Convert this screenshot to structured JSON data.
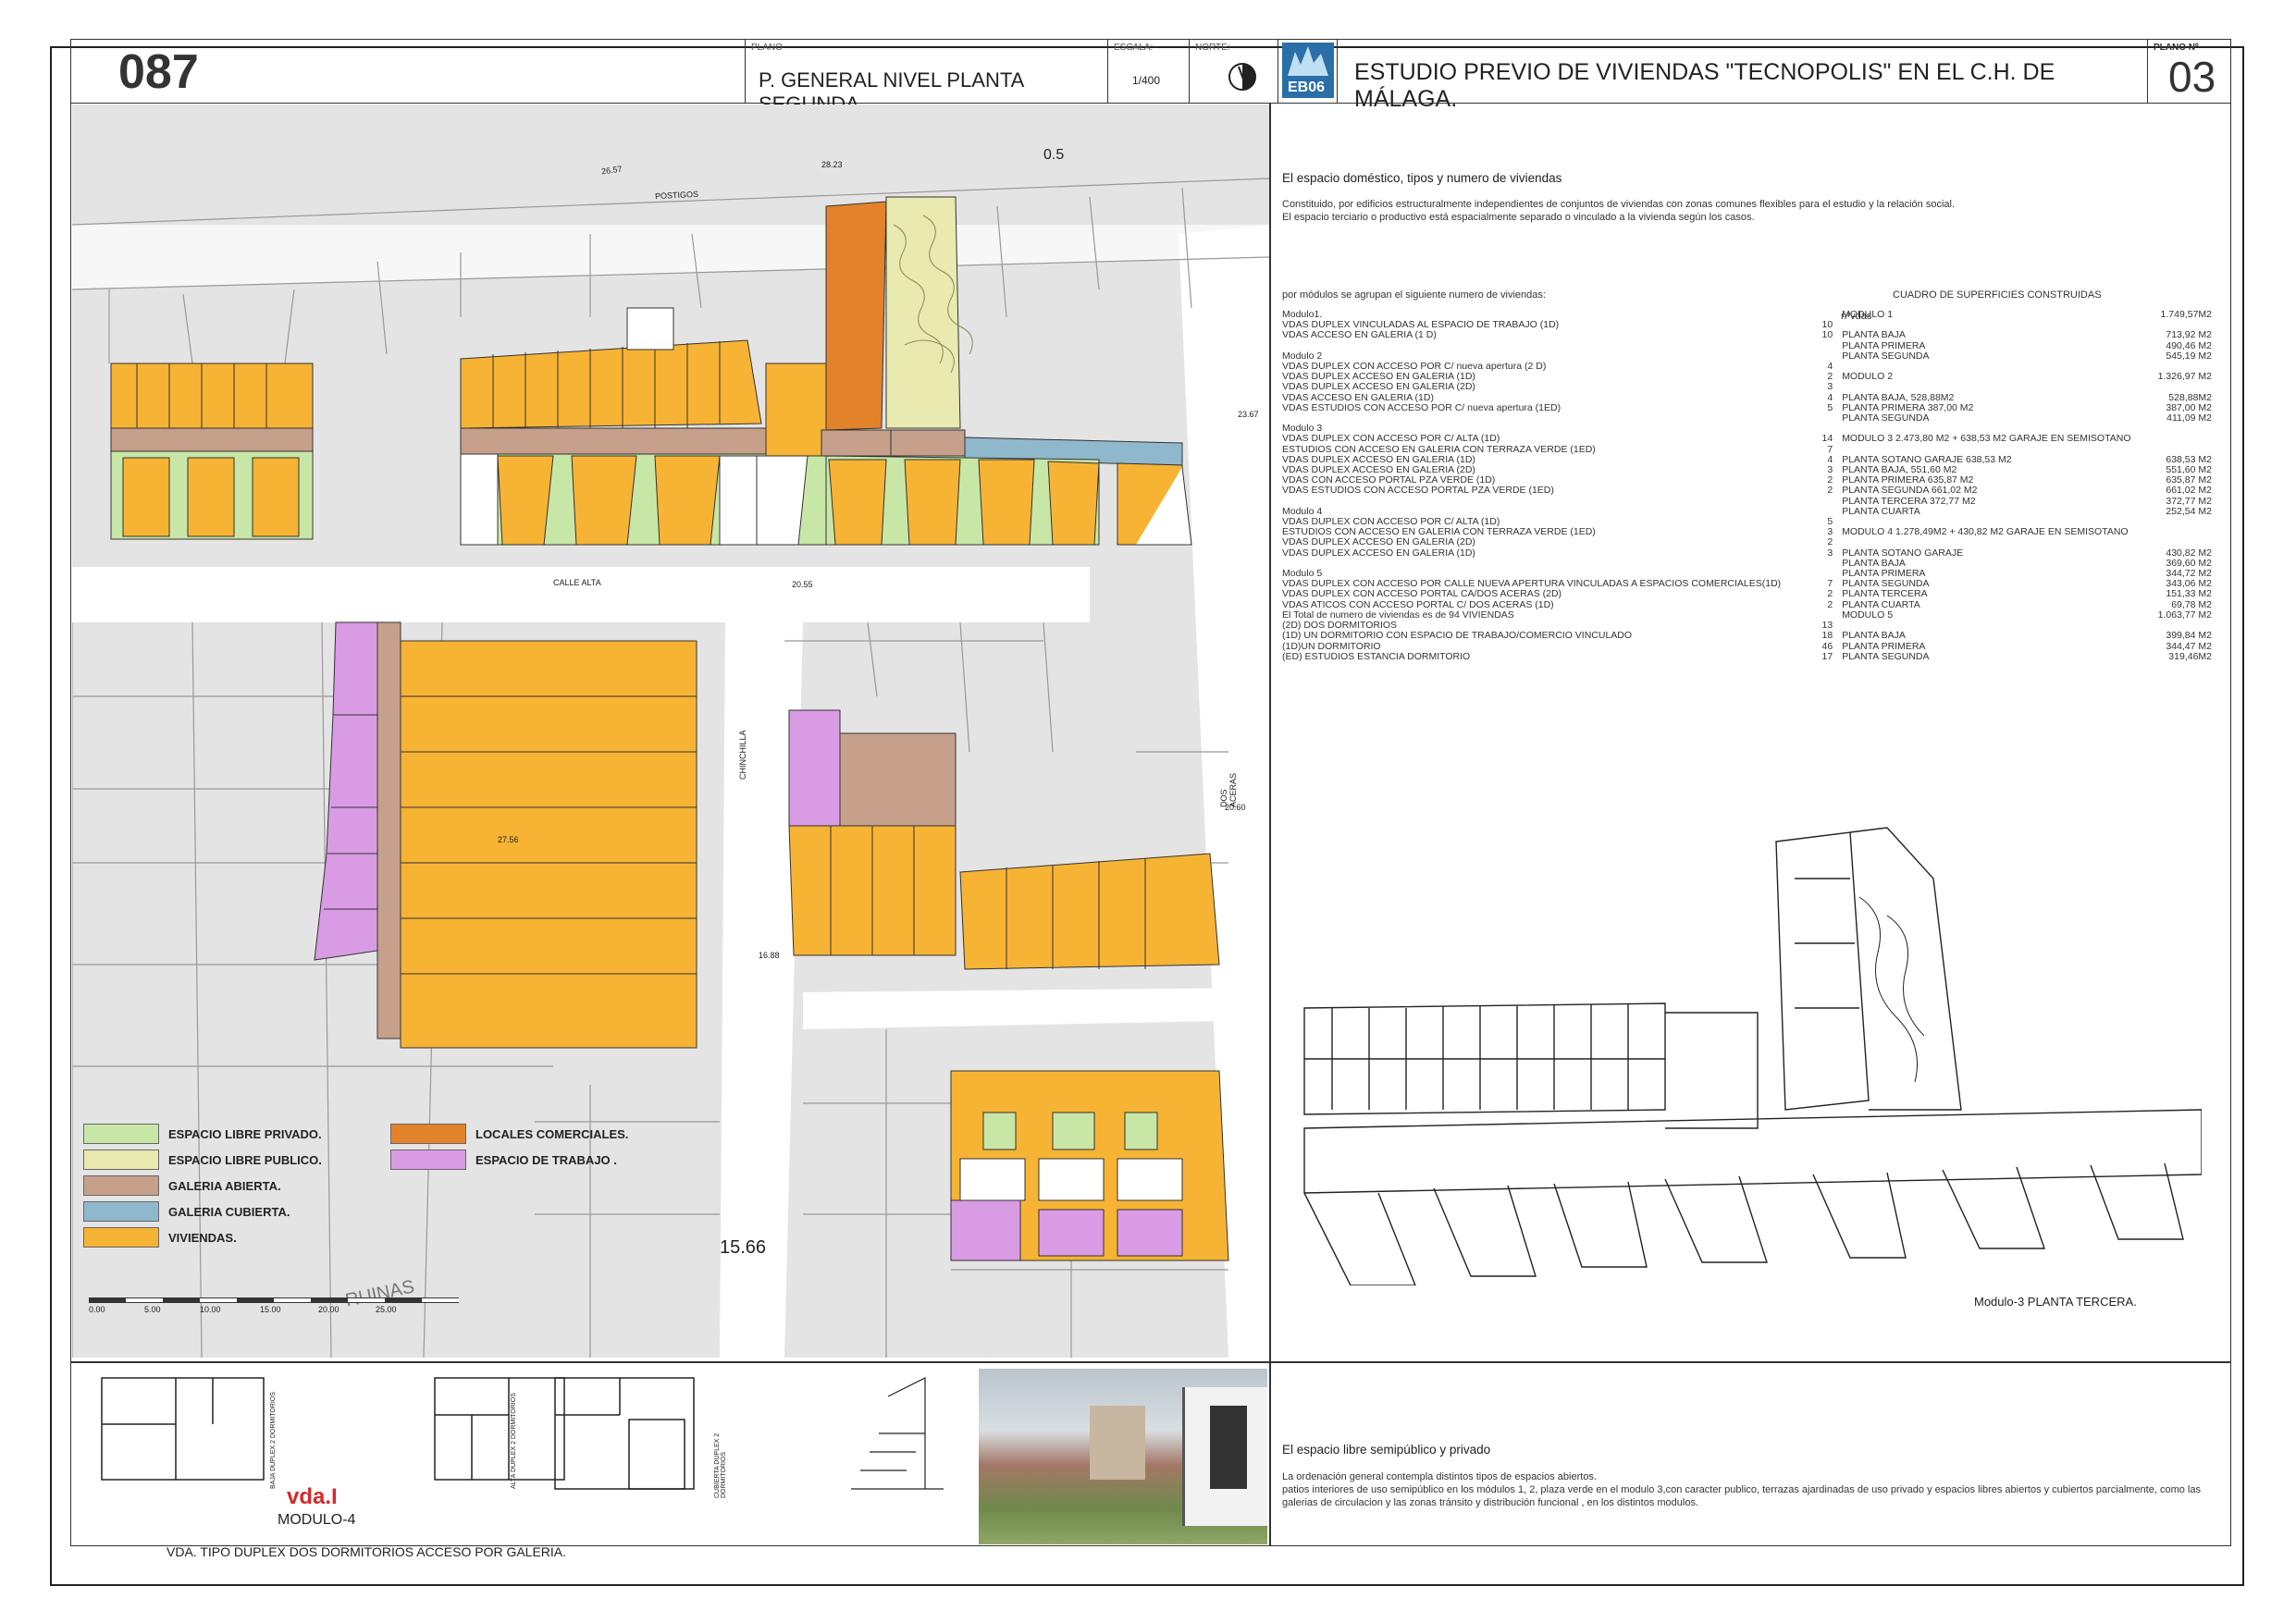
{
  "header": {
    "sheet_number": "087",
    "plano_caption": "PLANO",
    "plan_title": "P. GENERAL NIVEL PLANTA SEGUNDA.",
    "escala_caption": "ESCALA:",
    "scale": "1/400",
    "norte_caption": "NORTE:",
    "logo_text": "EB06",
    "project_title": "ESTUDIO PREVIO DE VIVIENDAS \"TECNOPOLIS\" EN EL  C.H. DE MÁLAGA.",
    "plano_no_caption": "PLANO Nº",
    "plano_no": "03"
  },
  "map": {
    "labels": {
      "postigos": "POSTIGOS",
      "calle_alta": "CALLE ALTA",
      "chinchilla": "CHINCHILLA",
      "dos_aceras": "DOS ACERAS",
      "ruinas": "RUINAS",
      "lv1": "0.5",
      "lv2": "26.57",
      "lv3": "28.23",
      "lv4": "20.55",
      "lv5": "23.67",
      "lv6": "27.56",
      "lv7": "16.88",
      "lv8": "20.60",
      "lv9": "15.66"
    },
    "scale_bar": [
      "0.00",
      "5.00",
      "10.00",
      "15.00",
      "20.00",
      "25.00"
    ],
    "legend": [
      {
        "label": "ESPACIO LIBRE PRIVADO.",
        "color": "#c8e7a7"
      },
      {
        "label": "ESPACIO LIBRE PUBLICO.",
        "color": "#e8eab0"
      },
      {
        "label": "GALERIA ABIERTA.",
        "color": "#c6a08a"
      },
      {
        "label": "GALERIA CUBIERTA.",
        "color": "#8fb8cc"
      },
      {
        "label": "VIVIENDAS.",
        "color": "#f6b334"
      },
      {
        "label": "LOCALES COMERCIALES.",
        "color": "#e2832c"
      },
      {
        "label": "ESPACIO DE TRABAJO .",
        "color": "#d99be3"
      }
    ]
  },
  "bottom": {
    "plan_labels": [
      "BAJA DUPLEX 2 DORMITORIOS",
      "ALTA DUPLEX 2 DORMITORIOS",
      "CUBIERTA DUPLEX 2 DORMITORIOS"
    ],
    "vda_title": "vda.I",
    "modulo": "MODULO-4",
    "caption": "VDA. TIPO DUPLEX  DOS DORMITORIOS ACCESO POR GALERIA."
  },
  "text": {
    "h1": "El espacio doméstico, tipos y numero de viviendas",
    "p1": "Constituido, por edificios estructuralmente independientes de conjuntos de viviendas con zonas comunes flexibles para el estudio y la relación social.",
    "p2": "El espacio terciario o productivo está espacialmente separado o vinculado a la vivienda según los casos.",
    "intro": "por módulos se agrupan el siguiente numero de viviendas:",
    "nvdas": "nºvdas",
    "cuadro": "CUADRO DE SUPERFICIES CONSTRUIDAS",
    "h2": "El espacio libre semipúblico y privado",
    "p3": "La ordenación general contempla distintos tipos de espacios abiertos.",
    "p4": "patios interiores de uso semipúblico en los módulos 1, 2, plaza verde en el modulo 3,con caracter publico, terrazas ajardinadas de uso privado y espacios libres abiertos y cubiertos parcialmente, como las galerias de circulacion y las zonas tránsito y distribución funcional , en los distintos modulos.",
    "modulo3_caption": "Modulo-3 PLANTA TERCERA."
  },
  "modules": [
    {
      "t": "Modulo1.",
      "n": "",
      "s": "MODULO 1",
      "v": "1.749,57M2"
    },
    {
      "t": "VDAS DUPLEX VINCULADAS AL ESPACIO DE TRABAJO (1D)",
      "n": "10",
      "s": "",
      "v": ""
    },
    {
      "t": "VDAS  ACCESO  EN GALERIA (1 D)",
      "n": "10",
      "s": "PLANTA BAJA",
      "v": "713,92 M2"
    },
    {
      "t": "",
      "n": "",
      "s": "PLANTA PRIMERA",
      "v": "490,46 M2"
    },
    {
      "t": "Modulo 2",
      "n": "",
      "s": "PLANTA SEGUNDA",
      "v": "545,19 M2"
    },
    {
      "t": "VDAS DUPLEX CON ACCESO POR C/ nueva apertura (2 D)",
      "n": "4",
      "s": "",
      "v": ""
    },
    {
      "t": "VDAS  DUPLEX  ACCESO EN GALERIA  (1D)",
      "n": "2",
      "s": "MODULO 2",
      "v": "1.326,97 M2"
    },
    {
      "t": "VDAS  DUPLEX  ACCESO EN GALERIA  (2D)",
      "n": "3",
      "s": "",
      "v": ""
    },
    {
      "t": "VDAS  ACCESO EN GALERIA (1D)",
      "n": "4",
      "s": "PLANTA BAJA,    528,88M2",
      "v": "528,88M2"
    },
    {
      "t": "VDAS ESTUDIOS CON ACCESO POR C/ nueva apertura (1ED)",
      "n": "5",
      "s": "PLANTA PRIMERA   387,00 M2",
      "v": "387,00 M2"
    },
    {
      "t": "",
      "n": "",
      "s": "PLANTA SEGUNDA",
      "v": "411,09 M2"
    },
    {
      "t": "Modulo 3",
      "n": "",
      "s": "",
      "v": ""
    },
    {
      "t": "VDAS DUPLEX CON  ACCESO POR C/ ALTA  (1D)",
      "n": "14",
      "s": "MODULO 3  2.473,80 M2 + 638,53 M2 GARAJE EN SEMISOTANO",
      "v": ""
    },
    {
      "t": "ESTUDIOS  CON ACCESO  EN GALERIA CON TERRAZA VERDE (1ED)",
      "n": "7",
      "s": "",
      "v": ""
    },
    {
      "t": "VDAS  DUPLEX  ACCESO EN GALERIA (1D)",
      "n": "4",
      "s": "PLANTA SOTANO GARAJE  638,53 M2",
      "v": "638,53 M2"
    },
    {
      "t": "VDAS  DUPLEX  ACCESO EN GALERIA  (2D)",
      "n": "3",
      "s": "PLANTA BAJA,    551,60 M2",
      "v": "551,60 M2"
    },
    {
      "t": "VDAS  CON  ACCESO PORTAL  PZA VERDE  (1D)",
      "n": "2",
      "s": "PLANTA PRIMERA    635,87 M2",
      "v": "635,87 M2"
    },
    {
      "t": "VDAS ESTUDIOS CON ACCESO PORTAL PZA VERDE (1ED)",
      "n": "2",
      "s": "PLANTA SEGUNDA    661,02 M2",
      "v": "661,02 M2"
    },
    {
      "t": "",
      "n": "",
      "s": "  PLANTA TERCERA    372,77 M2",
      "v": "372,77 M2"
    },
    {
      "t": "Modulo 4",
      "n": "",
      "s": "PLANTA CUARTA",
      "v": "252,54  M2"
    },
    {
      "t": "VDAS DUPLEX CON  ACCESO POR  C/ ALTA  (1D)",
      "n": "5",
      "s": "",
      "v": ""
    },
    {
      "t": "ESTUDIOS  CON ACCESO  EN GALERIA CON TERRAZA VERDE (1ED)",
      "n": "3",
      "s": "MODULO  4  1.278,49M2 + 430,82 M2 GARAJE EN SEMISOTANO",
      "v": ""
    },
    {
      "t": "VDAS  DUPLEX  ACCESO EN GALERIA (2D)",
      "n": "2",
      "s": "",
      "v": ""
    },
    {
      "t": "VDAS DUPLEX ACCESO EN GALERIA (1D)",
      "n": "3",
      "s": "PLANTA SOTANO GARAJE",
      "v": "430,82 M2"
    },
    {
      "t": "",
      "n": "",
      "s": "PLANTA BAJA",
      "v": "369,60 M2"
    },
    {
      "t": "Modulo 5",
      "n": "",
      "s": "PLANTA PRIMERA",
      "v": "344,72 M2"
    },
    {
      "t": "VDAS DUPLEX  CON ACCESO POR CALLE NUEVA APERTURA  VINCULADAS A ESPACIOS COMERCIALES(1D)",
      "n": "7",
      "s": "PLANTA SEGUNDA",
      "v": "343,06 M2"
    },
    {
      "t": "VDAS DUPLEX CON ACCESO PORTAL CA/DOS ACERAS   (2D)",
      "n": "2",
      "s": "  PLANTA TERCERA",
      "v": "151,33 M2"
    },
    {
      "t": "VDAS ATICOS CON ACCESO PORTAL C/ DOS ACERAS (1D)",
      "n": "2",
      "s": "PLANTA CUARTA",
      "v": "69,78 M2"
    },
    {
      "t": "",
      "n": "",
      "s": "",
      "v": ""
    },
    {
      "t": "      El  Total de numero de viviendas es de  94  VIVIENDAS",
      "n": "",
      "s": "MODULO 5",
      "v": "1.063,77 M2"
    },
    {
      "t": "      (2D) DOS DORMITORIOS",
      "n": "13",
      "s": "",
      "v": ""
    },
    {
      "t": "      (1D) UN DORMITORIO CON ESPACIO DE TRABAJO/COMERCIO  VINCULADO",
      "n": "18",
      "s": "PLANTA BAJA",
      "v": "399,84 M2"
    },
    {
      "t": "      (1D)UN DORMITORIO",
      "n": "46",
      "s": "PLANTA PRIMERA",
      "v": "344,47 M2"
    },
    {
      "t": "      (ED) ESTUDIOS ESTANCIA DORMITORIO",
      "n": "17",
      "s": "PLANTA SEGUNDA",
      "v": "319,46M2"
    }
  ]
}
